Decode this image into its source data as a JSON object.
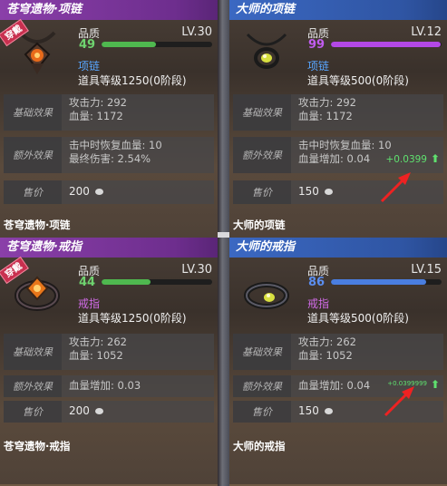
{
  "cards": [
    {
      "title": "苍穹遗物·项链",
      "tag": "穿戴",
      "quality_label": "品质",
      "quality_value": "49",
      "quality_color": "#6fd36f",
      "quality_fraction": 0.49,
      "bar_color": "#4fb84f",
      "level": "LV.30",
      "type_label": "项链",
      "type_color": "#58a6ff",
      "item_level": "道具等级1250(0阶段)",
      "base_label": "基础效果",
      "base_lines": [
        "攻击力: 292",
        "血量: 1172"
      ],
      "extra_label": "额外效果",
      "extra_lines": [
        "击中时恢复血量: 10",
        "最终伤害: 2.54%"
      ],
      "price_label": "售价",
      "price_value": "200",
      "bottom_title": "苍穹遗物·项链"
    },
    {
      "title": "大师的项链",
      "quality_label": "品质",
      "quality_value": "99",
      "quality_color": "#c15cf0",
      "quality_fraction": 0.99,
      "bar_color": "#b348e6",
      "level": "LV.12",
      "type_label": "项链",
      "type_color": "#58a6ff",
      "item_level": "道具等级500(0阶段)",
      "base_label": "基础效果",
      "base_lines": [
        "攻击力: 292",
        "血量: 1172"
      ],
      "extra_label": "额外效果",
      "extra_lines": [
        "击中时恢复血量: 10",
        "血量增加: 0.04"
      ],
      "delta": "+0.0399",
      "price_label": "售价",
      "price_value": "150",
      "bottom_title": "大师的项链"
    },
    {
      "title": "苍穹遗物·戒指",
      "tag": "穿戴",
      "quality_label": "品质",
      "quality_value": "44",
      "quality_color": "#6fd36f",
      "quality_fraction": 0.44,
      "bar_color": "#4fb84f",
      "level": "LV.30",
      "type_label": "戒指",
      "type_color": "#d06be6",
      "item_level": "道具等级1250(0阶段)",
      "base_label": "基础效果",
      "base_lines": [
        "攻击力: 262",
        "血量: 1052"
      ],
      "extra_label": "额外效果",
      "extra_lines": [
        "血量增加: 0.03"
      ],
      "price_label": "售价",
      "price_value": "200",
      "bottom_title": "苍穹遗物·戒指"
    },
    {
      "title": "大师的戒指",
      "quality_label": "品质",
      "quality_value": "86",
      "quality_color": "#5b8ef0",
      "quality_fraction": 0.86,
      "bar_color": "#4a7ee0",
      "level": "LV.15",
      "type_label": "戒指",
      "type_color": "#d06be6",
      "item_level": "道具等级500(0阶段)",
      "base_label": "基础效果",
      "base_lines": [
        "攻击力: 262",
        "血量: 1052"
      ],
      "extra_label": "额外效果",
      "extra_lines": [
        "血量增加: 0.04"
      ],
      "delta": "+0.0399999",
      "price_label": "售价",
      "price_value": "150",
      "bottom_title": "大师的戒指"
    }
  ]
}
